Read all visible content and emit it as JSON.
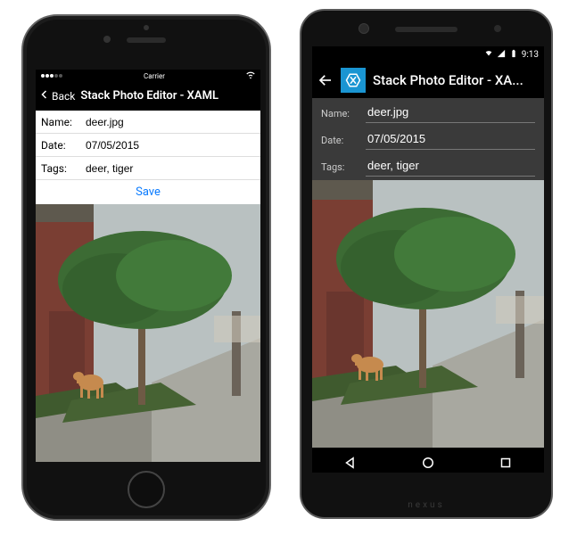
{
  "ios": {
    "status": {
      "carrier": "Carrier",
      "wifi_icon": "wifi"
    },
    "nav": {
      "back_label": "Back",
      "title": "Stack Photo Editor - XAML"
    },
    "form": {
      "name_label": "Name:",
      "name_value": "deer.jpg",
      "date_label": "Date:",
      "date_value": "07/05/2015",
      "tags_label": "Tags:",
      "tags_value": "deer, tiger",
      "save_label": "Save"
    }
  },
  "android": {
    "status": {
      "time": "9:13"
    },
    "appbar": {
      "title": "Stack Photo Editor - XA..."
    },
    "form": {
      "name_label": "Name:",
      "name_value": "deer.jpg",
      "date_label": "Date:",
      "date_value": "07/05/2015",
      "tags_label": "Tags:",
      "tags_value": "deer, tiger"
    },
    "chin_text": "nexus"
  },
  "colors": {
    "ios_accent": "#0a7bff",
    "android_accent": "#1a95d2"
  }
}
